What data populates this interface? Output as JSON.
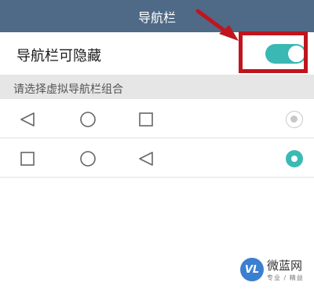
{
  "titlebar": {
    "title": "导航栏"
  },
  "toggle": {
    "label": "导航栏可隐藏",
    "state": "on",
    "color": "#39b8b4"
  },
  "annotation": {
    "color": "#c0151e"
  },
  "section": {
    "header": "请选择虚拟导航栏组合"
  },
  "options": [
    {
      "icons": [
        "back-triangle-icon",
        "home-circle-icon",
        "recents-square-icon"
      ],
      "selected": false
    },
    {
      "icons": [
        "recents-square-icon",
        "home-circle-icon",
        "back-triangle-icon"
      ],
      "selected": true
    }
  ],
  "watermark": {
    "logo_text": "VL",
    "name": "微蓝网",
    "tagline": "专业 / 精益"
  }
}
